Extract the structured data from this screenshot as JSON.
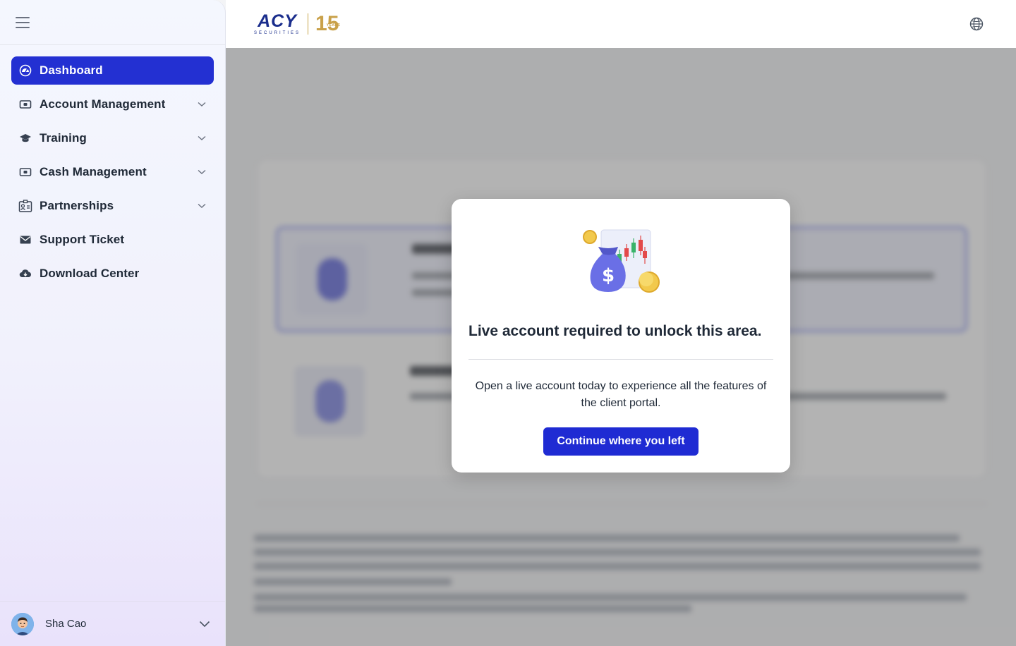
{
  "sidebar": {
    "menu_icon": "hamburger-icon",
    "items": [
      {
        "label": "Dashboard",
        "icon": "dashboard-icon",
        "active": true,
        "has_submenu": false
      },
      {
        "label": "Account Management",
        "icon": "wallet-icon",
        "active": false,
        "has_submenu": true
      },
      {
        "label": "Training",
        "icon": "graduation-cap-icon",
        "active": false,
        "has_submenu": true
      },
      {
        "label": "Cash Management",
        "icon": "cash-icon",
        "active": false,
        "has_submenu": true
      },
      {
        "label": "Partnerships",
        "icon": "id-card-icon",
        "active": false,
        "has_submenu": true
      },
      {
        "label": "Support Ticket",
        "icon": "envelope-icon",
        "active": false,
        "has_submenu": false
      },
      {
        "label": "Download Center",
        "icon": "cloud-download-icon",
        "active": false,
        "has_submenu": false
      }
    ],
    "user": {
      "name": "Sha Cao",
      "avatar_icon": "avatar"
    }
  },
  "header": {
    "logo_text": "ACY",
    "logo_subtext": "SECURITIES",
    "anniversary_text": "15",
    "anniversary_subtext": "YEARS",
    "language_icon": "globe-icon"
  },
  "modal": {
    "illustration": "money-bag-chart-icon",
    "title": "Live account required to unlock this area.",
    "description": "Open a live account today to experience all the features of the client portal.",
    "button_label": "Continue where you left"
  },
  "colors": {
    "accent": "#1f2bd3",
    "sidebar_active": "#2330d2",
    "text_primary": "#1f2937",
    "logo_gold": "#c9a14a",
    "logo_blue": "#1a2d8c"
  }
}
